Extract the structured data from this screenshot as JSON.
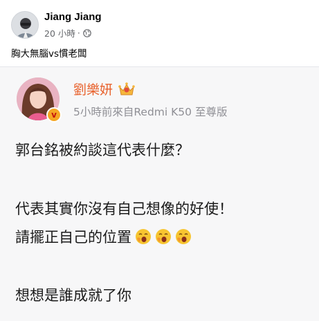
{
  "post": {
    "author": "Jiang Jiang",
    "time": "20 小時",
    "separator": "·",
    "privacy_icon": "globe-icon",
    "text": "胸大無腦vs慣老闆"
  },
  "screenshot": {
    "name": "劉樂妍",
    "verified_icon": "verified-v-badge-icon",
    "crown_icon": "crown-icon",
    "meta": "5小時前來自Redmi K50 至尊版",
    "lines": [
      "郭台銘被約談這代表什麼？",
      "代表其實你沒有自己想像的好使！",
      "請擺正自己的位置",
      "想想是誰成就了你"
    ],
    "emoji_icon": "yawning-face-emoji-icon",
    "name_color": "#e8612c"
  }
}
